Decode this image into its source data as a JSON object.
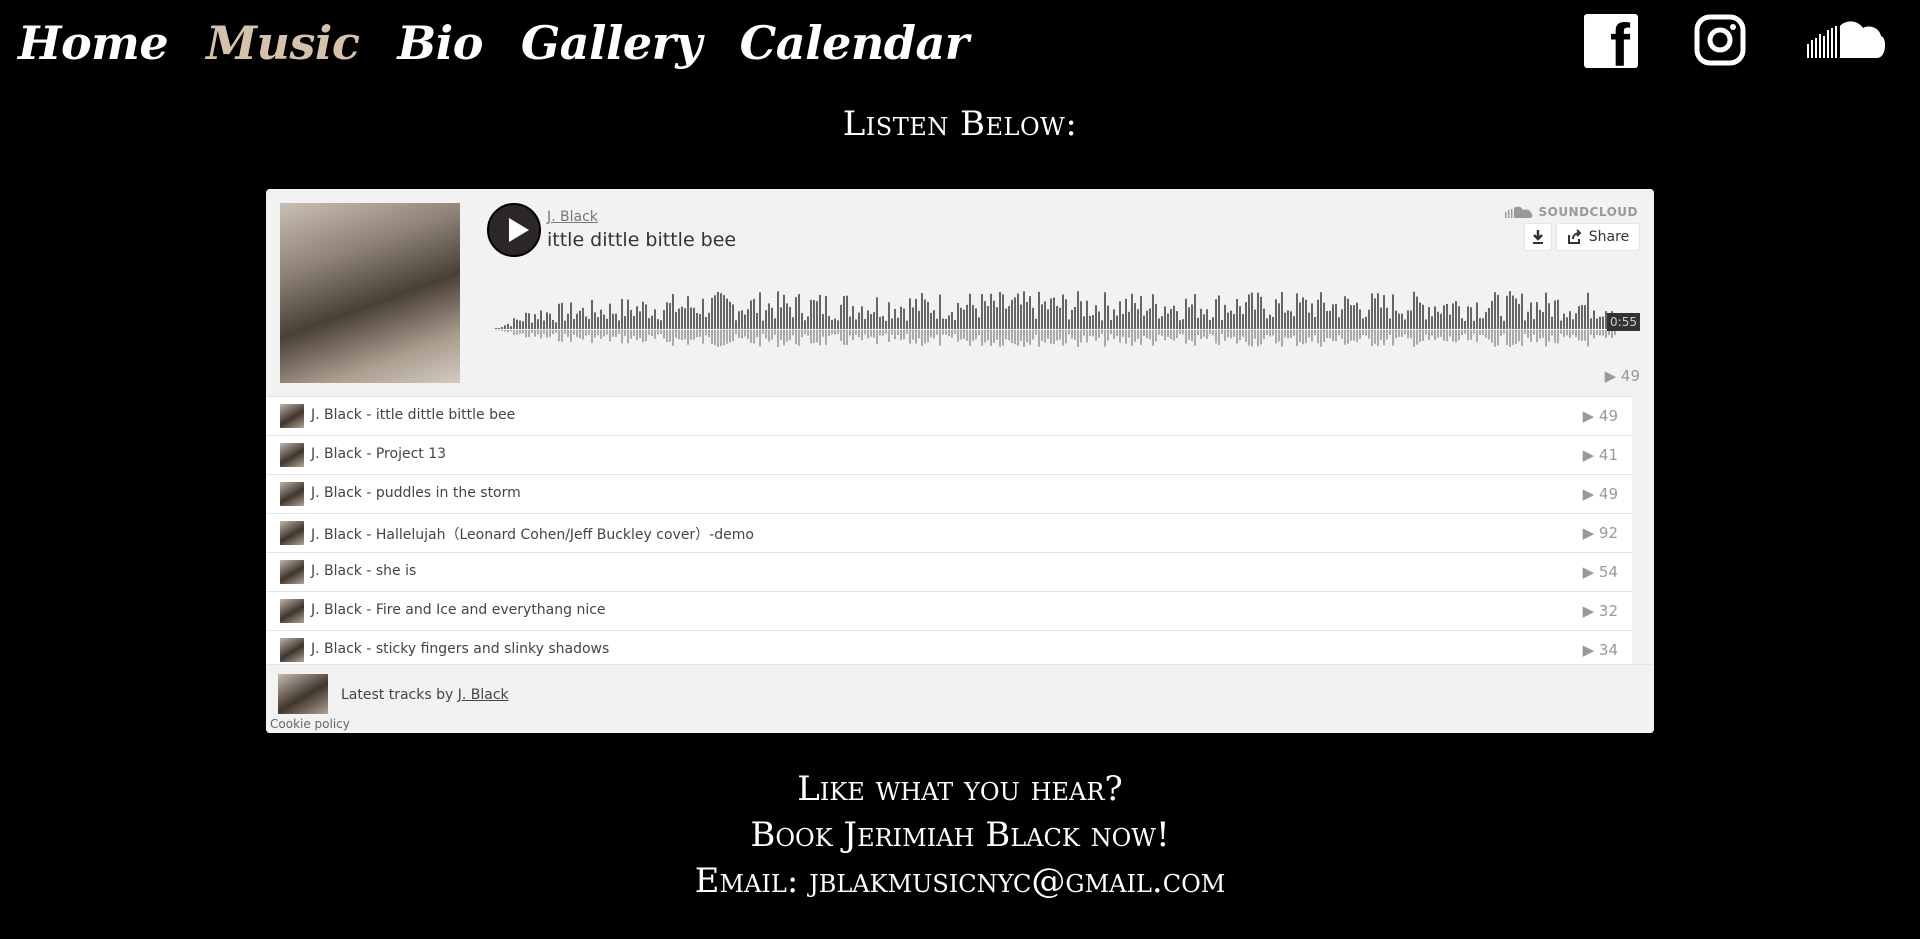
{
  "nav": {
    "items": [
      {
        "label": "Home",
        "active": false
      },
      {
        "label": "Music",
        "active": true
      },
      {
        "label": "Bio",
        "active": false
      },
      {
        "label": "Gallery",
        "active": false
      },
      {
        "label": "Calendar",
        "active": false
      }
    ],
    "active_color": "#d6c2aa"
  },
  "social": {
    "facebook_glyph": "f",
    "icons": [
      "facebook-icon",
      "instagram-icon",
      "soundcloud-icon"
    ]
  },
  "listen_heading": "Listen Below:",
  "player": {
    "artist": "J. Black",
    "title": "ittle dittle bittle bee",
    "brand": "SOUNDCLOUD",
    "share_label": "Share",
    "duration": "0:55",
    "plays": "49",
    "tracks": [
      {
        "label": "J. Black - ittle dittle bittle bee",
        "plays": "49"
      },
      {
        "label": "J. Black - Project 13",
        "plays": "41"
      },
      {
        "label": "J. Black - puddles in the storm",
        "plays": "49"
      },
      {
        "label": "J. Black - Hallelujah（Leonard Cohen/Jeff Buckley cover）-demo",
        "plays": "92"
      },
      {
        "label": "J. Black - she is",
        "plays": "54"
      },
      {
        "label": "J. Black - Fire and Ice and everythang nice",
        "plays": "32"
      },
      {
        "label": "J. Black - sticky fingers and slinky shadows",
        "plays": "34"
      }
    ],
    "footer_prefix": "Latest tracks by ",
    "footer_link": "J. Black",
    "cookie_policy": "Cookie policy"
  },
  "cta": {
    "line1": "Like what you hear?",
    "line2": "Book Jerimiah Black now!",
    "line3": "Email: jblakmusicnyc@gmail.com"
  }
}
